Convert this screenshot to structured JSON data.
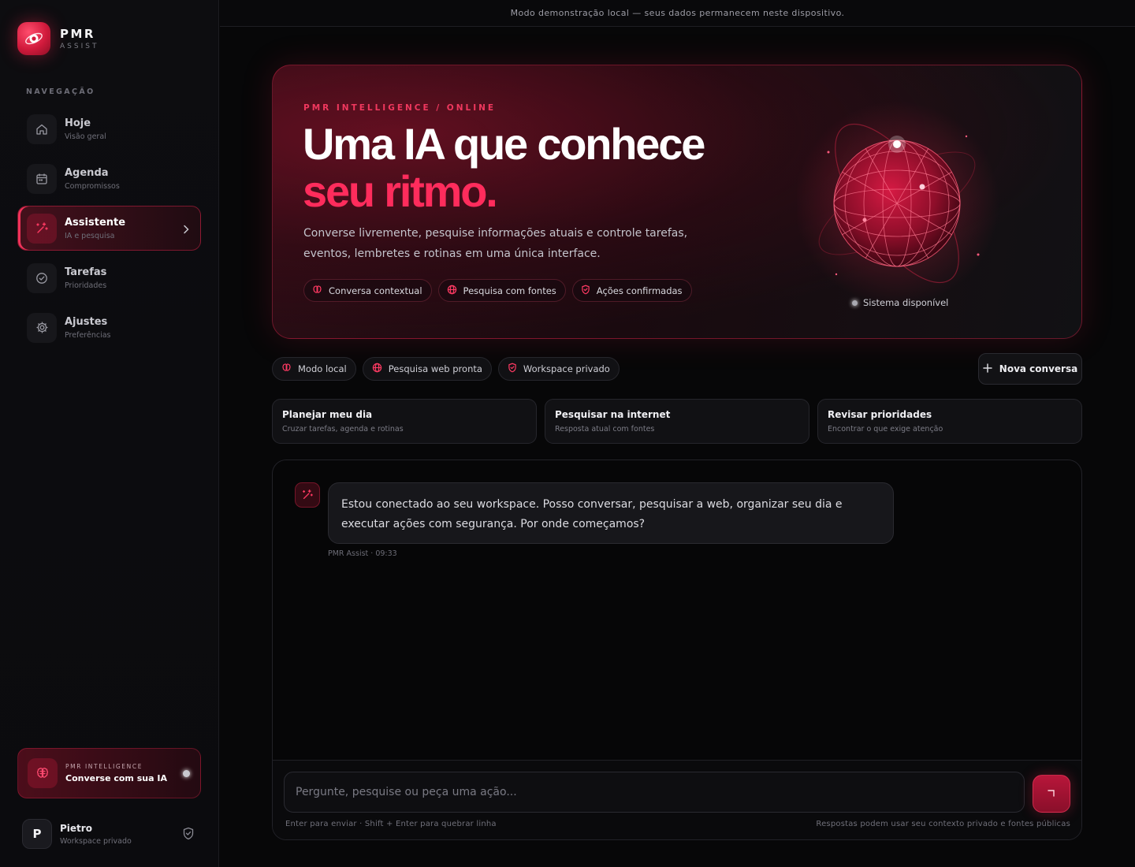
{
  "app": {
    "name": "PMR",
    "sub": "ASSIST",
    "banner": "Modo demonstração local — seus dados permanecem neste dispositivo."
  },
  "sidebar": {
    "nav_label": "NAVEGAÇÃO",
    "items": [
      {
        "title": "Hoje",
        "sub": "Visão geral",
        "icon": "home-icon",
        "active": false
      },
      {
        "title": "Agenda",
        "sub": "Compromissos",
        "icon": "calendar-icon",
        "active": false
      },
      {
        "title": "Assistente",
        "sub": "IA e pesquisa",
        "icon": "sparkles-icon",
        "active": true
      },
      {
        "title": "Tarefas",
        "sub": "Prioridades",
        "icon": "check-circle-icon",
        "active": false
      },
      {
        "title": "Ajustes",
        "sub": "Preferências",
        "icon": "gear-icon",
        "active": false
      }
    ],
    "promo": {
      "kicker": "PMR INTELLIGENCE",
      "title": "Converse com sua IA"
    },
    "user": {
      "initial": "P",
      "name": "Pietro",
      "sub": "Workspace privado"
    }
  },
  "hero": {
    "kicker": "PMR INTELLIGENCE / ONLINE",
    "title_line1": "Uma IA que conhece",
    "title_line2": "seu ritmo.",
    "description": "Converse livremente, pesquise informações atuais e controle tarefas, eventos, lembretes e rotinas em uma única interface.",
    "chips": [
      {
        "label": "Conversa contextual",
        "icon": "brain-icon"
      },
      {
        "label": "Pesquisa com fontes",
        "icon": "globe-icon"
      },
      {
        "label": "Ações confirmadas",
        "icon": "shield-check-icon"
      }
    ],
    "status": "Sistema disponível"
  },
  "pills": [
    {
      "label": "Modo local",
      "icon": "brain-icon"
    },
    {
      "label": "Pesquisa web pronta",
      "icon": "globe-icon"
    },
    {
      "label": "Workspace privado",
      "icon": "shield-check-icon"
    }
  ],
  "new_chat_label": "Nova conversa",
  "cards": [
    {
      "title": "Planejar meu dia",
      "sub": "Cruzar tarefas, agenda e rotinas"
    },
    {
      "title": "Pesquisar na internet",
      "sub": "Resposta atual com fontes"
    },
    {
      "title": "Revisar prioridades",
      "sub": "Encontrar o que exige atenção"
    }
  ],
  "chat": {
    "message": "Estou conectado ao seu workspace. Posso conversar, pesquisar a web, organizar seu dia e executar ações com segurança. Por onde começamos?",
    "meta": "PMR Assist · 09:33",
    "placeholder": "Pergunte, pesquise ou peça uma ação...",
    "hint_left": "Enter para enviar · Shift + Enter para quebrar linha",
    "hint_right": "Respostas podem usar seu contexto privado e fontes públicas"
  },
  "colors": {
    "accent": "#ff2c5c",
    "accent_dark": "#b8163a",
    "background": "#070708"
  }
}
